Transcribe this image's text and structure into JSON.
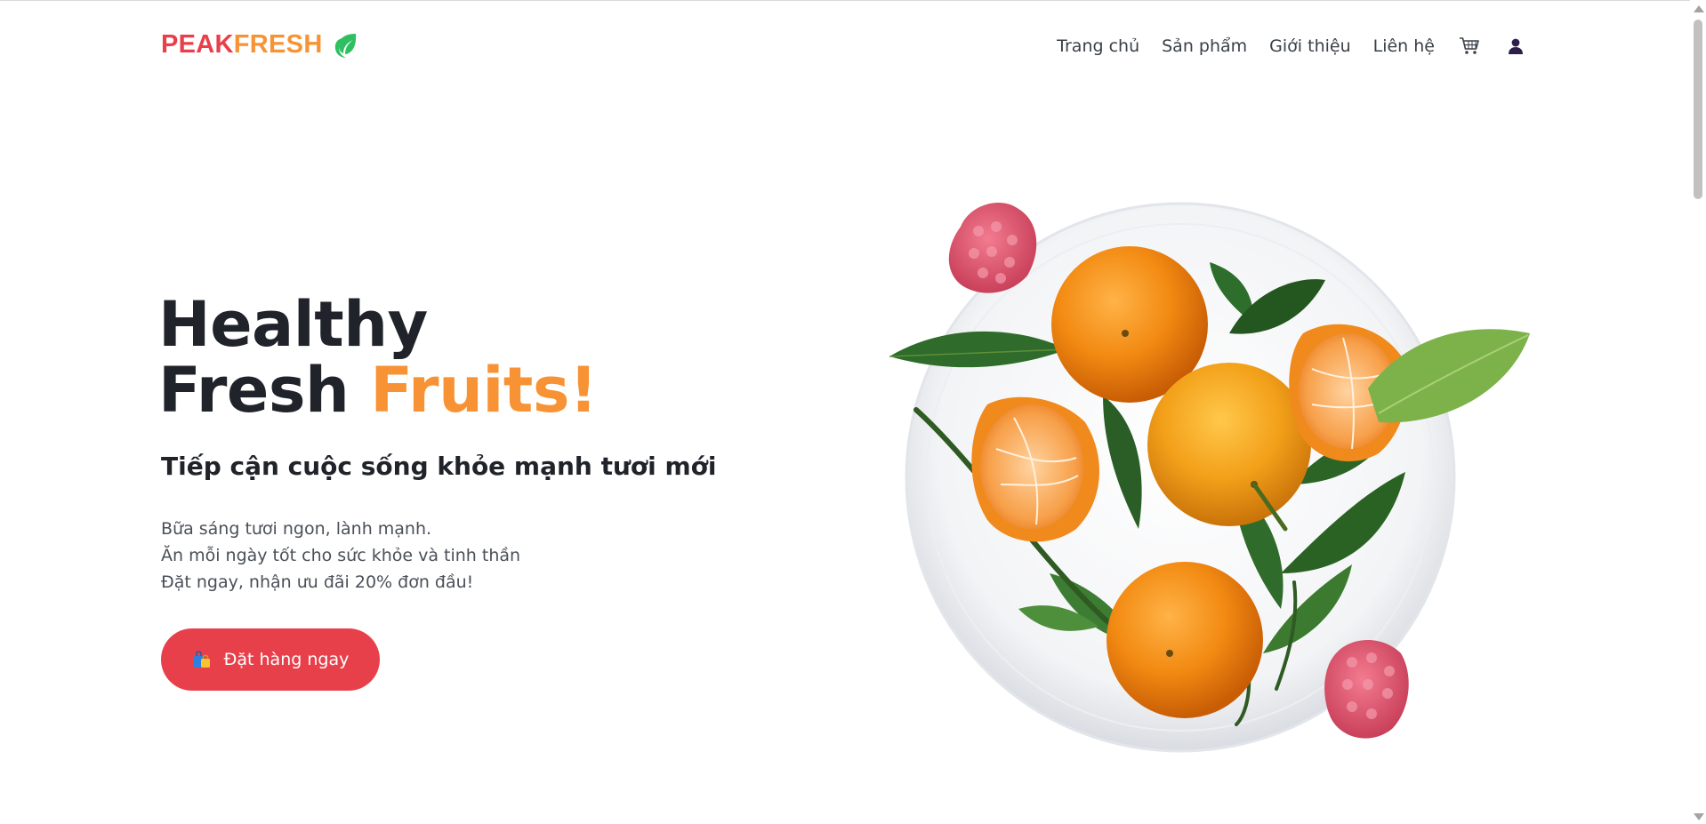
{
  "brand": {
    "name_part1": "PEAK",
    "name_part2": "FRESH",
    "color_primary": "#e8404a",
    "color_secondary": "#f79334",
    "leaf_icon": "leaf-icon"
  },
  "nav": {
    "items": [
      {
        "label": "Trang chủ"
      },
      {
        "label": "Sản phẩm"
      },
      {
        "label": "Giới thiệu"
      },
      {
        "label": "Liên hệ"
      }
    ],
    "cart_icon": "cart-icon",
    "user_icon": "user-icon"
  },
  "hero": {
    "title_line1": "Healthy",
    "title_line2_plain": "Fresh ",
    "title_line2_accent": "Fruits!",
    "subtitle": "Tiếp cận cuộc sống khỏe mạnh tươi mới",
    "lines": [
      "Bữa sáng tươi ngon, lành mạnh.",
      "Ăn mỗi ngày tốt cho sức khỏe và tinh thần",
      "Đặt ngay, nhận ưu đãi 20% đơn đầu!"
    ],
    "cta_label": "Đặt hàng ngay",
    "cta_icon": "shopping-bags-icon",
    "image": "plate-of-tangerines-with-leaves-and-raspberries"
  }
}
